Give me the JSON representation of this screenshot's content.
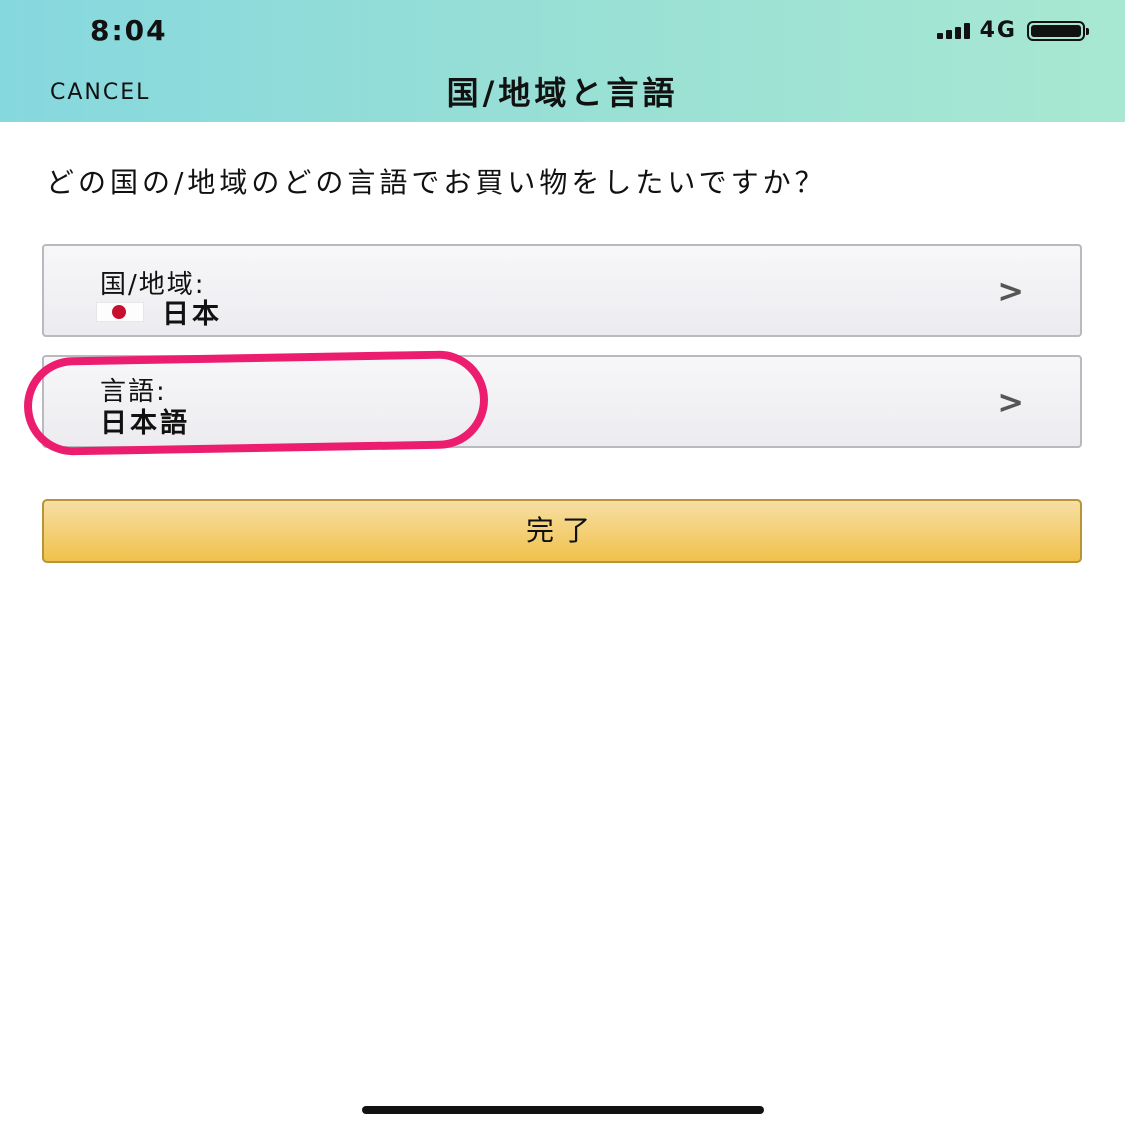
{
  "status_bar": {
    "time": "8:04",
    "network": "4G",
    "signal_icon": "signal-bars-icon",
    "battery_icon": "battery-icon"
  },
  "nav": {
    "cancel_label": "CANCEL",
    "title": "国/地域と言語"
  },
  "question": "どの国の/地域のどの言語でお買い物をしたいですか？",
  "country_row": {
    "label": "国/地域:",
    "value": "日本",
    "flag_icon": "japan-flag-icon",
    "chevron": ">"
  },
  "language_row": {
    "label": "言語:",
    "value": "日本語",
    "chevron": ">"
  },
  "done_button": {
    "label": "完了"
  },
  "colors": {
    "highlight_ring": "#ec1d6e",
    "done_button": "#f0c14b"
  }
}
